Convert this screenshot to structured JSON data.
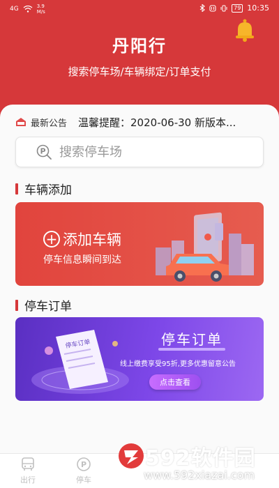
{
  "status_bar": {
    "network": "4G",
    "speed_value": "3.9",
    "speed_unit": "M/s",
    "battery": "79",
    "time": "10:35"
  },
  "header": {
    "title": "丹阳行",
    "subtitle": "搜索停车场/车辆绑定/订单支付",
    "bell_icon": "bell-icon",
    "bg_color": "#d6383a"
  },
  "notice": {
    "label": "最新公告",
    "text": "温馨提醒：2020-06-30 新版本..."
  },
  "search": {
    "placeholder": "搜索停车场",
    "icon": "parking-search-icon"
  },
  "vehicle_section": {
    "title": "车辆添加",
    "banner_title": "添加车辆",
    "banner_subtitle": "停车信息瞬间到达"
  },
  "order_section": {
    "title": "停车订单",
    "receipt_label": "停车订单",
    "banner_title": "停车订单",
    "banner_desc": "线上缴费享受95折,更多优惠留意公告",
    "button_label": "点击查看"
  },
  "tabbar": {
    "items": [
      {
        "label": "出行",
        "icon": "bus-icon"
      },
      {
        "label": "停车",
        "icon": "parking-icon"
      }
    ]
  },
  "watermark": {
    "brand": "592软件园",
    "url": "www.592xiazai.com"
  }
}
